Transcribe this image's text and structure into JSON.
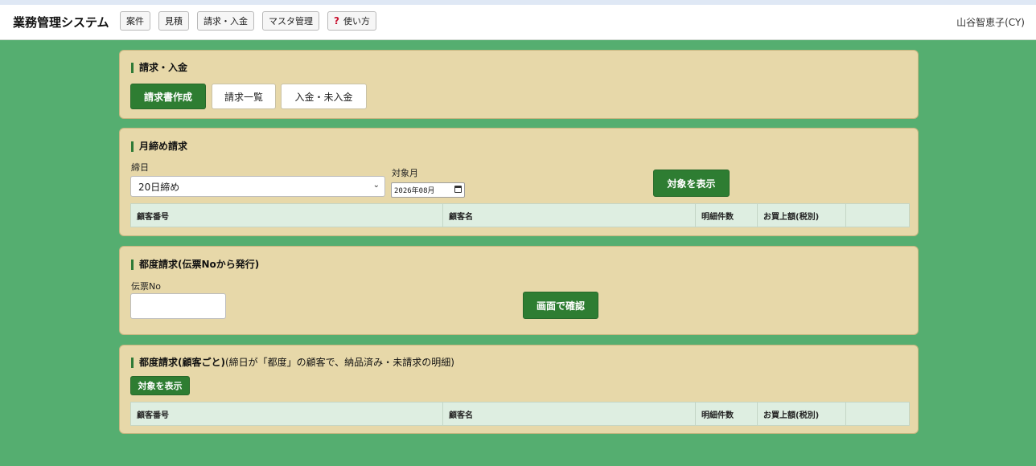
{
  "header": {
    "app_title": "業務管理システム",
    "nav": [
      "案件",
      "見積",
      "請求・入金",
      "マスタ管理"
    ],
    "help_label": "使い方",
    "help_icon": "question-mark-icon",
    "user": "山谷智恵子(CY)"
  },
  "billing": {
    "title": "請求・入金",
    "tabs": [
      "請求書作成",
      "請求一覧",
      "入金・未入金"
    ]
  },
  "monthly": {
    "title": "月締め請求",
    "closing_label": "締日",
    "closing_value": "20日締め",
    "month_label": "対象月",
    "month_value": "2026年08月",
    "show_button": "対象を表示",
    "columns": [
      "顧客番号",
      "顧客名",
      "明細件数",
      "お買上額(税別)",
      ""
    ]
  },
  "per_slip": {
    "title": "都度請求(伝票Noから発行)",
    "slip_label": "伝票No",
    "slip_value": "",
    "confirm_button": "画面で確認"
  },
  "per_customer": {
    "title": "都度請求(顧客ごと)",
    "note": "(締日が「都度」の顧客で、納品済み・未請求の明細)",
    "show_button": "対象を表示",
    "columns": [
      "顧客番号",
      "顧客名",
      "明細件数",
      "お買上額(税別)",
      ""
    ]
  },
  "colors": {
    "background": "#55ae70",
    "panel": "#e7d8a9",
    "accent_green": "#2e7d32",
    "table_header": "#deeee1"
  }
}
